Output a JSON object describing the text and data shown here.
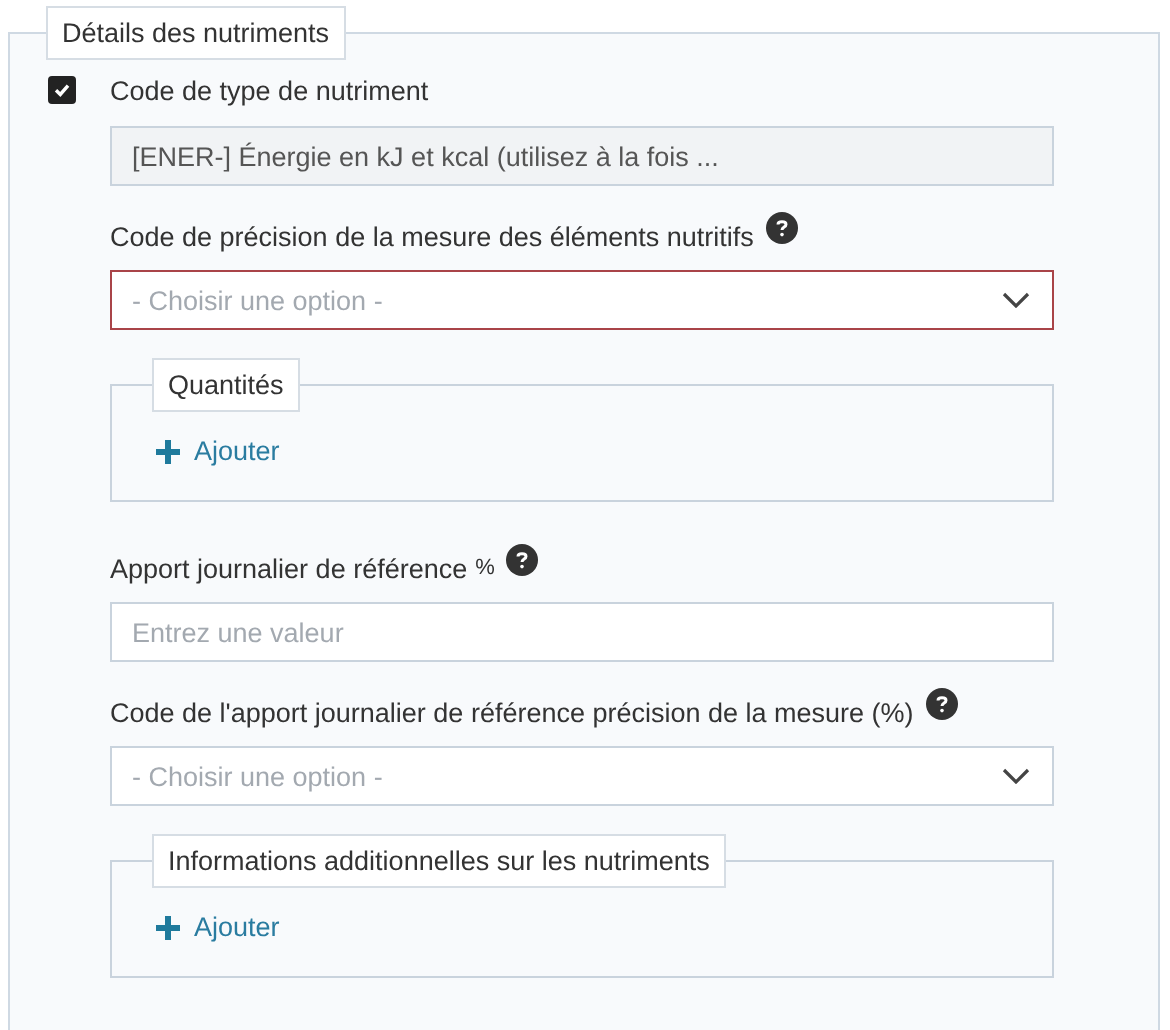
{
  "section": {
    "title": "Détails des nutriments",
    "checkbox": {
      "label": "Code de type de nutriment",
      "checked": true
    },
    "items": [
      {
        "kind": "text",
        "value": "[ENER-] Énergie en kJ et kcal (utilisez à la fois ...",
        "disabled": true
      },
      {
        "kind": "select",
        "label": "Code de précision de la mesure des éléments nutritifs",
        "help": true,
        "placeholder": "- Choisir une option -",
        "invalid": true
      },
      {
        "kind": "group",
        "title": "Quantités",
        "action": "Ajouter"
      },
      {
        "kind": "text",
        "label": "Apport journalier de référence",
        "unit": "%",
        "help": true,
        "placeholder": "Entrez une valeur",
        "disabled": false
      },
      {
        "kind": "select",
        "label": "Code de l'apport journalier de référence précision de la mesure (%)",
        "help": true,
        "placeholder": "- Choisir une option -",
        "invalid": false
      },
      {
        "kind": "group",
        "title": "Informations additionnelles sur les nutriments",
        "action": "Ajouter"
      }
    ]
  }
}
